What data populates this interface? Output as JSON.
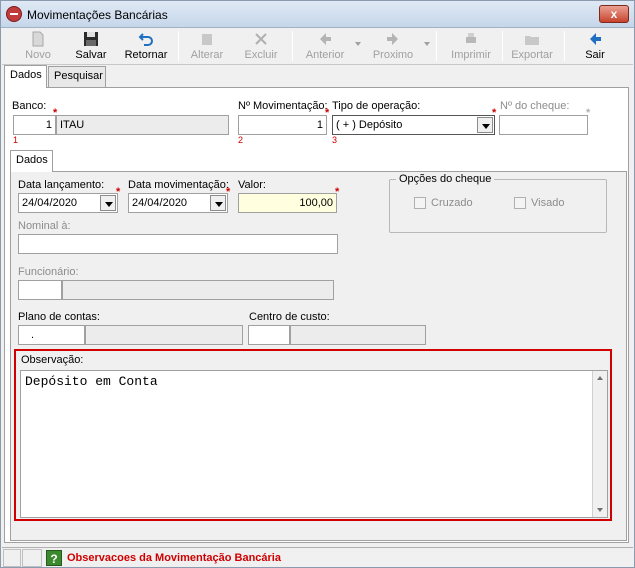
{
  "window": {
    "title": "Movimentações Bancárias",
    "close_label": "x"
  },
  "toolbar": {
    "novo": "Novo",
    "salvar": "Salvar",
    "retornar": "Retornar",
    "alterar": "Alterar",
    "excluir": "Excluir",
    "anterior": "Anterior",
    "proximo": "Proximo",
    "imprimir": "Imprimir",
    "exportar": "Exportar",
    "sair": "Sair"
  },
  "tabs": {
    "dados": "Dados",
    "pesquisar": "Pesquisar"
  },
  "top_fields": {
    "banco_label": "Banco:",
    "banco_code": "1",
    "banco_name": "ITAU",
    "banco_idx": "1",
    "num_mov_label": "Nº Movimentação:",
    "num_mov_value": "1",
    "num_mov_idx": "2",
    "tipo_label": "Tipo de operação:",
    "tipo_value": "( + ) Depósito",
    "tipo_idx": "3",
    "cheque_label": "Nº do cheque:",
    "cheque_value": ""
  },
  "inner_tab": {
    "dados": "Dados"
  },
  "form": {
    "data_lanc_label": "Data lançamento:",
    "data_lanc_value": "24/04/2020",
    "data_mov_label": "Data movimentação:",
    "data_mov_value": "24/04/2020",
    "valor_label": "Valor:",
    "valor_value": "100,00",
    "nominal_label": "Nominal à:",
    "nominal_value": "",
    "funcionario_label": "Funcionário:",
    "plano_label": "Plano de contas:",
    "plano_code": ".",
    "centro_label": "Centro de custo:",
    "opcoes_title": "Opções do cheque",
    "cruzado_label": "Cruzado",
    "visado_label": "Visado",
    "obs_label": "Observação:",
    "obs_value": "Depósito em Conta"
  },
  "required_mark": "*",
  "status": {
    "help_glyph": "?",
    "message": "Observacoes da Movimentação Bancária"
  },
  "colors": {
    "required": "#d00000",
    "highlight_border": "#d00000",
    "valor_bg": "#ffffe0"
  }
}
